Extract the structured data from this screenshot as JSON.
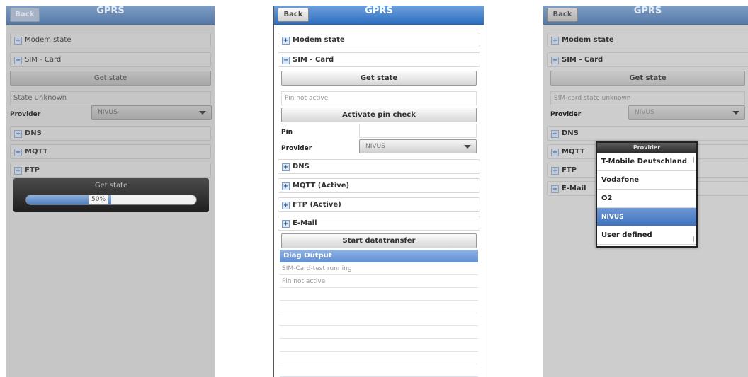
{
  "panel_left": {
    "back": "Back",
    "title": "GPRS",
    "modem_state": "Modem state",
    "sim_card": "SIM - Card",
    "get_state_button": "Get state",
    "state_text": "State unknown",
    "provider_label": "Provider",
    "provider_value": "NIVUS",
    "dns": "DNS",
    "mqtt": "MQTT",
    "ftp": "FTP",
    "progress_title": "Get state",
    "progress_label": "50%",
    "progress_fraction": 0.5
  },
  "panel_middle": {
    "back": "Back",
    "title": "GPRS",
    "modem_state": "Modem state",
    "sim_card": "SIM - Card",
    "get_state_button": "Get state",
    "pin_status": "Pin not active",
    "activate_pin_button": "Activate pin check",
    "pin_label": "Pin",
    "pin_value": "",
    "provider_label": "Provider",
    "provider_value": "NIVUS",
    "dns": "DNS",
    "mqtt": "MQTT (Active)",
    "ftp": "FTP (Active)",
    "email": "E-Mail",
    "start_transfer_button": "Start datatransfer",
    "diag_title": "Diag Output",
    "diag_lines": [
      "SIM-Card-test running",
      "Pin not active",
      "",
      "",
      "",
      "",
      "",
      "",
      ""
    ]
  },
  "panel_right": {
    "back": "Back",
    "title": "GPRS",
    "modem_state": "Modem state",
    "sim_card": "SIM - Card",
    "get_state_button": "Get state",
    "sim_state_text": "SIM-card state unknown",
    "provider_label": "Provider",
    "provider_value": "NIVUS",
    "dns": "DNS",
    "mqtt": "MQTT",
    "ftp": "FTP",
    "email": "E-Mail",
    "popup_title": "Provider",
    "popup_options": [
      "T-Mobile Deutschland",
      "Vodafone",
      "O2",
      "NIVUS",
      "User defined"
    ],
    "popup_selected": "NIVUS"
  },
  "icons": {
    "expand": "+",
    "collapse": "−"
  },
  "colors": {
    "header_blue": "#2d6fc2",
    "selected_blue": "#3f72bd",
    "diag_blue": "#5f8fd4"
  }
}
